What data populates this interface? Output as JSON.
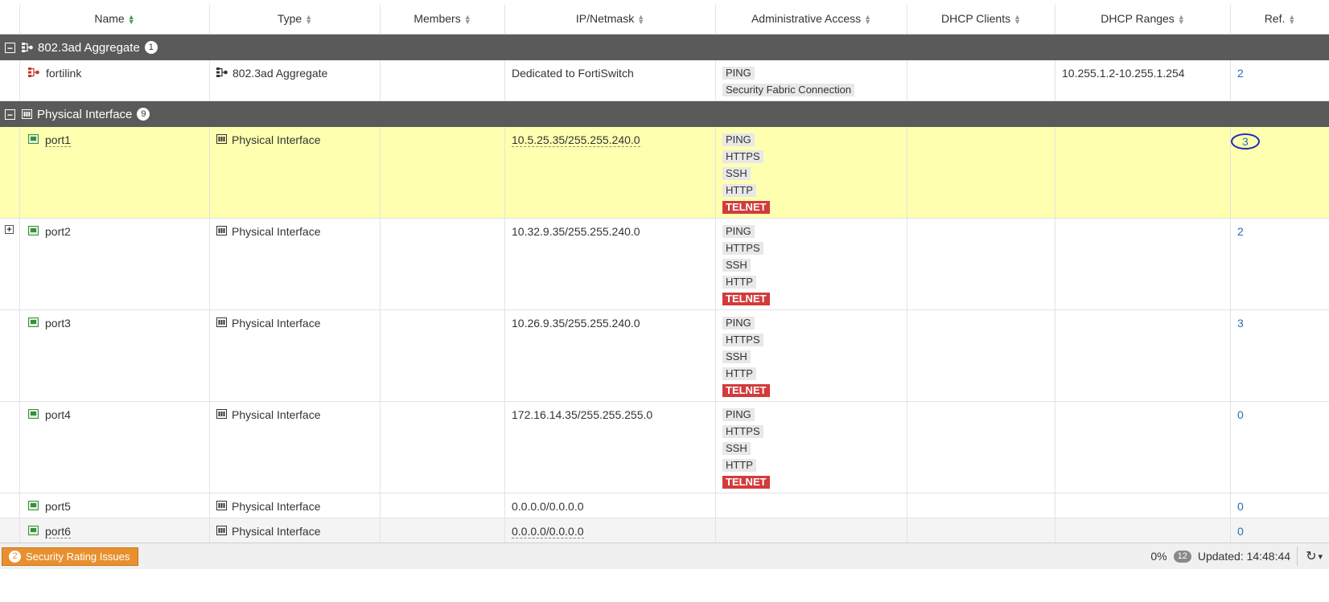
{
  "columns": {
    "name": "Name",
    "type": "Type",
    "members": "Members",
    "ip": "IP/Netmask",
    "admin": "Administrative Access",
    "dhcp_clients": "DHCP Clients",
    "dhcp_ranges": "DHCP Ranges",
    "ref": "Ref."
  },
  "groups": [
    {
      "label": "802.3ad Aggregate",
      "count": "1",
      "toggle": "−",
      "rows": [
        {
          "name": "fortilink",
          "type": "802.3ad Aggregate",
          "members": "",
          "ip": "Dedicated to FortiSwitch",
          "access": [
            "PING",
            "Security Fabric Connection"
          ],
          "dhcp_clients": "",
          "dhcp_ranges": "10.255.1.2-10.255.1.254",
          "ref": "2"
        }
      ]
    },
    {
      "label": "Physical Interface",
      "count": "9",
      "toggle": "−",
      "rows": [
        {
          "name": "port1",
          "type": "Physical Interface",
          "ip": "10.5.25.35/255.255.240.0",
          "access": [
            "PING",
            "HTTPS",
            "SSH",
            "HTTP",
            "TELNET"
          ],
          "ref": "3"
        },
        {
          "name": "port2",
          "type": "Physical Interface",
          "ip": "10.32.9.35/255.255.240.0",
          "access": [
            "PING",
            "HTTPS",
            "SSH",
            "HTTP",
            "TELNET"
          ],
          "ref": "2",
          "expand": "+"
        },
        {
          "name": "port3",
          "type": "Physical Interface",
          "ip": "10.26.9.35/255.255.240.0",
          "access": [
            "PING",
            "HTTPS",
            "SSH",
            "HTTP",
            "TELNET"
          ],
          "ref": "3"
        },
        {
          "name": "port4",
          "type": "Physical Interface",
          "ip": "172.16.14.35/255.255.255.0",
          "access": [
            "PING",
            "HTTPS",
            "SSH",
            "HTTP",
            "TELNET"
          ],
          "ref": "0"
        },
        {
          "name": "port5",
          "type": "Physical Interface",
          "ip": "0.0.0.0/0.0.0.0",
          "access": [],
          "ref": "0"
        },
        {
          "name": "port6",
          "type": "Physical Interface",
          "ip": "0.0.0.0/0.0.0.0",
          "access": [],
          "ref": "0"
        }
      ]
    }
  ],
  "footer": {
    "security_count": "2",
    "security_label": "Security Rating Issues",
    "percent": "0%",
    "percent_badge": "12",
    "updated": "Updated: 14:48:44",
    "refresh_icon": "↻",
    "dropdown_icon": "▾"
  },
  "colors": {
    "group_bg": "#5a5a5a",
    "highlight_bg": "#ffffb0",
    "telnet_bg": "#d23b3b",
    "link": "#2a6ead",
    "security_btn": "#e8902f"
  },
  "icons": {
    "sort": "sort-arrows-icon",
    "aggregate": "aggregate-icon",
    "physical": "physical-interface-icon",
    "port": "port-icon"
  }
}
